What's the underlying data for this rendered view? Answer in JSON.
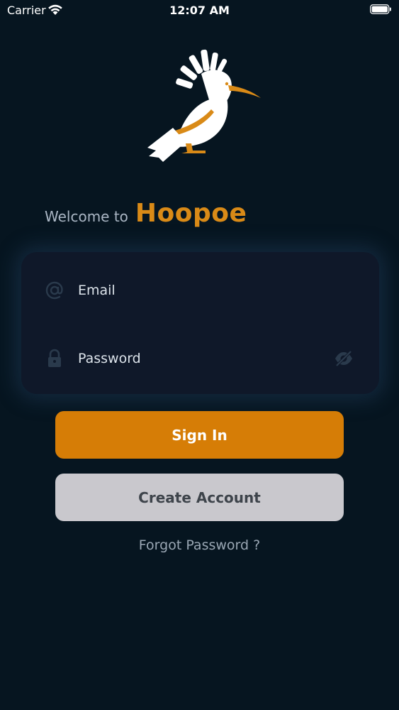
{
  "status_bar": {
    "carrier": "Carrier",
    "time": "12:07 AM",
    "wifi_icon": "wifi-icon",
    "battery_icon": "battery-icon"
  },
  "branding": {
    "logo_icon": "hoopoe-bird-logo",
    "welcome": "Welcome to",
    "app_name": "Hoopoe"
  },
  "login_form": {
    "email": {
      "icon": "at-sign-icon",
      "placeholder": "Email",
      "value": ""
    },
    "password": {
      "icon": "lock-icon",
      "placeholder": "Password",
      "value": "",
      "toggle_icon": "eye-slash-icon"
    }
  },
  "actions": {
    "sign_in_label": "Sign In",
    "create_account_label": "Create Account",
    "forgot_password_label": "Forgot Password ?"
  },
  "colors": {
    "background": "#061520",
    "accent": "#d67d06",
    "card": "#0f1829",
    "secondary_button": "#c9c8cd"
  }
}
